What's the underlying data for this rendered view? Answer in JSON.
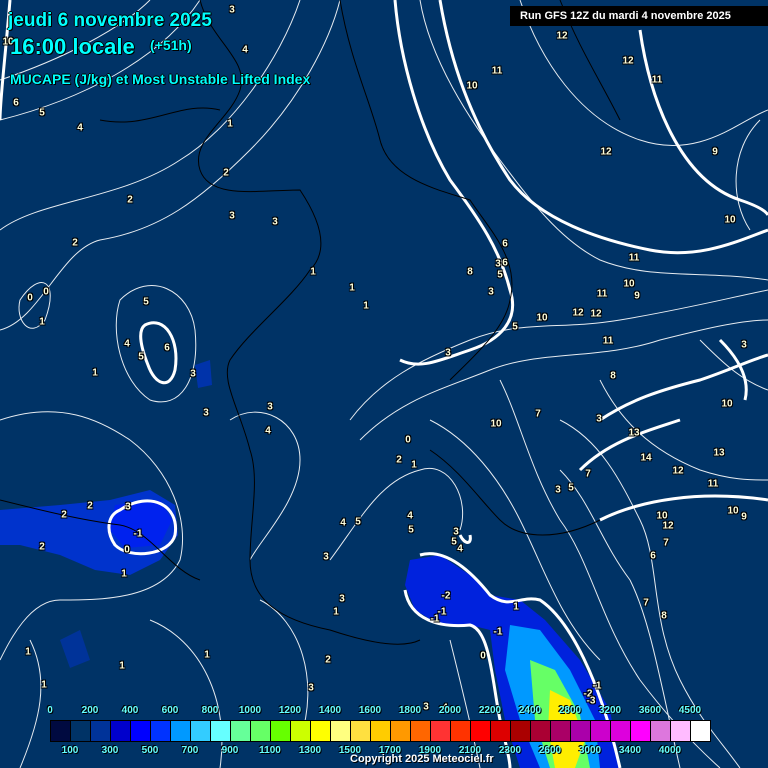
{
  "header": {
    "date": "jeudi 6 novembre 2025",
    "time": "16:00 locale",
    "lead": "(+51h)",
    "parameter": "MUCAPE (J/kg) et Most Unstable Lifted Index",
    "run": "Run GFS 12Z du mardi 4 novembre 2025"
  },
  "legend": {
    "colors": [
      "#000a40",
      "#003366",
      "#003399",
      "#0000cc",
      "#0000ff",
      "#0033ff",
      "#0099ff",
      "#33ccff",
      "#66ffff",
      "#66ff99",
      "#66ff66",
      "#66ff00",
      "#ccff00",
      "#ffff00",
      "#ffff80",
      "#ffe040",
      "#ffcc00",
      "#ff9900",
      "#ff6600",
      "#ff3333",
      "#ff3300",
      "#ff0000",
      "#dd0000",
      "#aa0000",
      "#aa0033",
      "#aa0066",
      "#aa00aa",
      "#cc00cc",
      "#dd00dd",
      "#ff00ff",
      "#dd77dd",
      "#ffbbff",
      "#ffffff"
    ],
    "top_ticks": [
      "0",
      "200",
      "400",
      "600",
      "800",
      "1000",
      "1200",
      "1400",
      "1600",
      "1800",
      "2000",
      "2200",
      "2400",
      "2800",
      "3200",
      "3600",
      "4500"
    ],
    "bottom_ticks": [
      "100",
      "300",
      "500",
      "700",
      "900",
      "1100",
      "1300",
      "1500",
      "1700",
      "1900",
      "2100",
      "2300",
      "2600",
      "3000",
      "3400",
      "4000"
    ]
  },
  "lifted_index_labels": [
    "10",
    "6",
    "5",
    "4",
    "3",
    "3",
    "2",
    "1",
    "2",
    "3",
    "4",
    "3",
    "2",
    "0",
    "0",
    "1",
    "5",
    "6",
    "4",
    "5",
    "3",
    "3",
    "1",
    "1",
    "1",
    "1",
    "2",
    "3",
    "4",
    "3",
    "3",
    "4",
    "5",
    "2",
    "1",
    "0",
    "2",
    "2",
    "-1",
    "0",
    "1",
    "4",
    "5",
    "3",
    "4",
    "5",
    "1",
    "2",
    "-2",
    "-1",
    "-1",
    "-1",
    "1",
    "0",
    "-1",
    "-2",
    "-3",
    "1",
    "3",
    "1",
    "1",
    "1",
    "3",
    "4",
    "10",
    "11",
    "12",
    "11",
    "12",
    "12",
    "11",
    "10",
    "9",
    "10",
    "9",
    "11",
    "6",
    "3",
    "3",
    "5",
    "10",
    "12",
    "11",
    "12",
    "8",
    "3",
    "5",
    "8",
    "6",
    "10",
    "3",
    "10",
    "7",
    "13",
    "14",
    "13",
    "12",
    "11",
    "10",
    "9",
    "10",
    "12",
    "7",
    "6",
    "7",
    "8",
    "3",
    "5",
    "3",
    "7"
  ],
  "copyright": "Copyright 2025 Meteociel.fr"
}
